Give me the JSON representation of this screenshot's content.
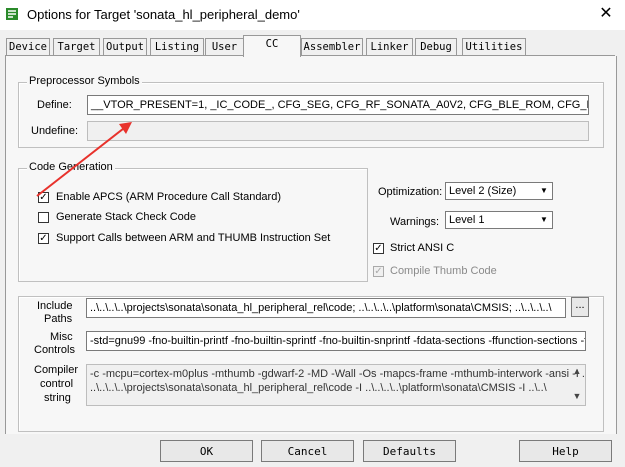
{
  "window": {
    "title": "Options for Target 'sonata_hl_peripheral_demo'",
    "close_glyph": "✕"
  },
  "tabs": [
    {
      "label": "Device",
      "active": false
    },
    {
      "label": "Target",
      "active": false
    },
    {
      "label": "Output",
      "active": false
    },
    {
      "label": "Listing",
      "active": false
    },
    {
      "label": "User",
      "active": false
    },
    {
      "label": "CC",
      "active": true
    },
    {
      "label": "Assembler",
      "active": false
    },
    {
      "label": "Linker",
      "active": false
    },
    {
      "label": "Debug",
      "active": false
    },
    {
      "label": "Utilities",
      "active": false
    }
  ],
  "preprocessor": {
    "group_title": "Preprocessor Symbols",
    "define_label": "Define:",
    "define_value": "__VTOR_PRESENT=1, _IC_CODE_, CFG_SEG, CFG_RF_SONATA_A0V2, CFG_BLE_ROM, CFG_B",
    "undefine_label": "Undefine:",
    "undefine_value": ""
  },
  "code_generation": {
    "group_title": "Code Generation",
    "enable_apcs": {
      "label": "Enable APCS (ARM Procedure Call Standard)",
      "checked": true
    },
    "stack_check": {
      "label": "Generate Stack Check Code",
      "checked": false
    },
    "arm_thumb": {
      "label": "Support Calls between ARM and THUMB Instruction Set",
      "checked": true
    }
  },
  "optimization": {
    "label": "Optimization:",
    "value": "Level 2 (Size)"
  },
  "warnings": {
    "label": "Warnings:",
    "value": "Level 1"
  },
  "strict_ansi": {
    "label": "Strict ANSI C",
    "checked": true
  },
  "compile_thumb": {
    "label": "Compile Thumb Code",
    "checked": true,
    "disabled": true
  },
  "include_paths": {
    "label_line1": "Include",
    "label_line2": "Paths",
    "value": "..\\..\\..\\..\\projects\\sonata\\sonata_hl_peripheral_rel\\code; ..\\..\\..\\..\\platform\\sonata\\CMSIS; ..\\..\\..\\..\\",
    "browse_label": "..."
  },
  "misc_controls": {
    "label_line1": "Misc",
    "label_line2": "Controls",
    "value": "-std=gnu99 -fno-builtin-printf -fno-builtin-sprintf -fno-builtin-snprintf -fdata-sections -ffunction-sections -fno-co"
  },
  "compiler_control": {
    "label_line1": "Compiler",
    "label_line2": "control",
    "label_line3": "string",
    "line1": "-c -mcpu=cortex-m0plus -mthumb -gdwarf-2 -MD -Wall -Os -mapcs-frame -mthumb-interwork -ansi -I ..",
    "line2": "..\\..\\..\\..\\projects\\sonata\\sonata_hl_peripheral_rel\\code -I ..\\..\\..\\..\\platform\\sonata\\CMSIS -I ..\\..\\"
  },
  "buttons": {
    "ok": "OK",
    "cancel": "Cancel",
    "defaults": "Defaults",
    "help": "Help"
  },
  "colors": {
    "annotation_arrow": "#e8322c",
    "app_icon": "#2a8a2a"
  }
}
